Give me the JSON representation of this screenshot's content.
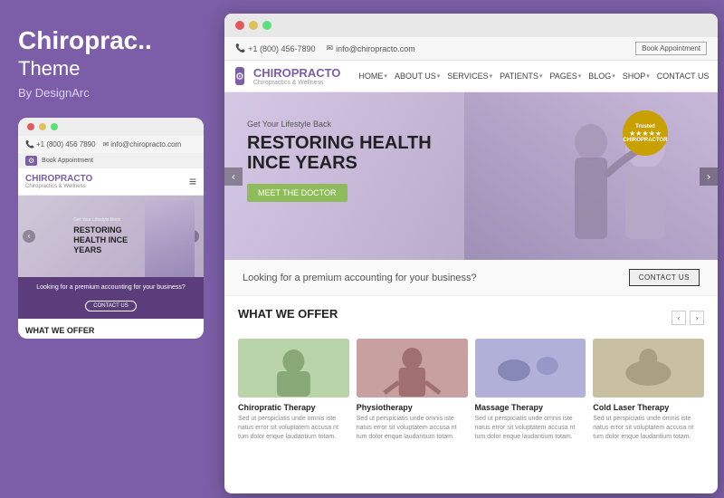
{
  "left": {
    "title": "Chiroprac..",
    "subtitle": "Theme",
    "byline": "By DesignArc",
    "mobile": {
      "dots": [
        "red",
        "yellow",
        "green"
      ],
      "topbar": {
        "phone": "+1 (800) 456 7890",
        "email": "info@chiropracto.com",
        "book_btn": "Book Appointment"
      },
      "logo_text1": "CHIRO",
      "logo_text2": "PRACTO",
      "logo_sub": "Chiropractics & Wellness",
      "hamburger": "≡",
      "hero": {
        "small_text": "Get Your Lifestyle Back",
        "title": "RESTORING HEALTH INCE YEARS"
      },
      "promo_text": "Looking for a premium accounting for your business?",
      "contact_btn": "CONTACT US",
      "offer_title": "WHAT WE OFFER"
    }
  },
  "right": {
    "dots": [
      "red",
      "yellow",
      "green"
    ],
    "topbar": {
      "phone": "+1 (800) 456-7890",
      "email": "info@chiropracto.com",
      "book_btn": "Book Appointment"
    },
    "nav": {
      "logo_text1": "CHIRO",
      "logo_text2": "PRACTO",
      "logo_sub": "Chiropractics & Wellness",
      "links": [
        {
          "label": "HOME",
          "has_arrow": true
        },
        {
          "label": "ABOUT US",
          "has_arrow": true
        },
        {
          "label": "SERVICES",
          "has_arrow": true
        },
        {
          "label": "PATIENTS",
          "has_arrow": true
        },
        {
          "label": "PAGES",
          "has_arrow": true
        },
        {
          "label": "BLOG",
          "has_arrow": true
        },
        {
          "label": "SHOP",
          "has_arrow": true
        },
        {
          "label": "CONTACT US",
          "has_arrow": false
        }
      ]
    },
    "hero": {
      "small_text": "Get Your Lifestyle Back",
      "title_line1": "RESTORING HEALTH",
      "title_line2": "INCE YEARS",
      "meet_btn": "MEET THE DOCTOR",
      "badge_text": "Trusted",
      "badge_sub": "CHIROPRACTOR"
    },
    "promo": {
      "text": "Looking for a premium accounting for your business?",
      "contact_btn": "CONTACT US"
    },
    "offer": {
      "title": "WHAT WE OFFER",
      "cards": [
        {
          "title": "Chiropratic Therapy",
          "text": "Sed ut perspiciatis unde omnis iste natus error sit voluptatem accusa nt tum dolor enque laudantium totam."
        },
        {
          "title": "Physiotherapy",
          "text": "Sed ut perspiciatis unde omnis iste natus error sit voluptatem accusa nt tum dolor enque laudantium totam."
        },
        {
          "title": "Massage Therapy",
          "text": "Sed ut perspiciatis unde omnis iste natus error sit voluptatem accusa nt tum dolor enque laudantium totam."
        },
        {
          "title": "Cold Laser Therapy",
          "text": "Sed ut perspiciatis unde omnis iste natus error sit voluptatem accusa nt tum dolor enque laudantium totam."
        }
      ]
    }
  }
}
